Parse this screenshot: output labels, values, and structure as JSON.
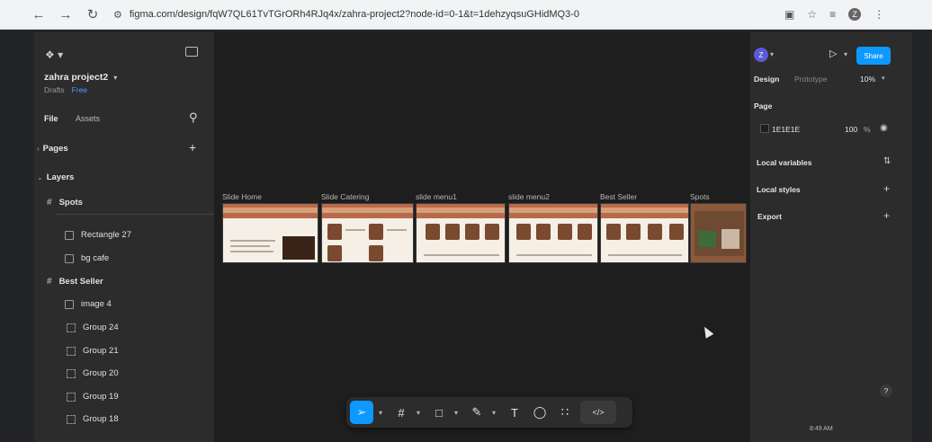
{
  "browser": {
    "url": "figma.com/design/fqW7QL61TvTGrORh4RJq4x/zahra-project2?node-id=0-1&t=1dehzyqsuGHidMQ3-0"
  },
  "file": {
    "name": "zahra project2",
    "location": "Drafts",
    "plan": "Free"
  },
  "left_tabs": {
    "file": "File",
    "assets": "Assets"
  },
  "sections": {
    "pages": "Pages",
    "layers": "Layers"
  },
  "layers": [
    {
      "label": "Spots",
      "kind": "frame"
    },
    {
      "label": "Rectangle 27",
      "kind": "image"
    },
    {
      "label": "bg cafe",
      "kind": "image"
    },
    {
      "label": "Best Seller",
      "kind": "frame"
    },
    {
      "label": "image 4",
      "kind": "image"
    },
    {
      "label": "Group 24",
      "kind": "group"
    },
    {
      "label": "Group 21",
      "kind": "group"
    },
    {
      "label": "Group 20",
      "kind": "group"
    },
    {
      "label": "Group 19",
      "kind": "group"
    },
    {
      "label": "Group 18",
      "kind": "group"
    }
  ],
  "frames": [
    {
      "label": "Slide Home"
    },
    {
      "label": "Slide Catering"
    },
    {
      "label": "slide menu1"
    },
    {
      "label": "slide menu2"
    },
    {
      "label": "Best Seller"
    },
    {
      "label": "Spots"
    }
  ],
  "right_panel": {
    "avatar": "Z",
    "share": "Share",
    "tab_design": "Design",
    "tab_prototype": "Prototype",
    "zoom": "10%",
    "page_heading": "Page",
    "page_color": "1E1E1E",
    "page_opacity": "100",
    "page_opacity_unit": "%",
    "local_variables": "Local variables",
    "local_styles": "Local styles",
    "export": "Export",
    "help": "?"
  },
  "taskbar": {
    "time": "8:49 AM"
  },
  "colors": {
    "accent": "#0d99ff",
    "frame_header": "#b86a4a"
  }
}
